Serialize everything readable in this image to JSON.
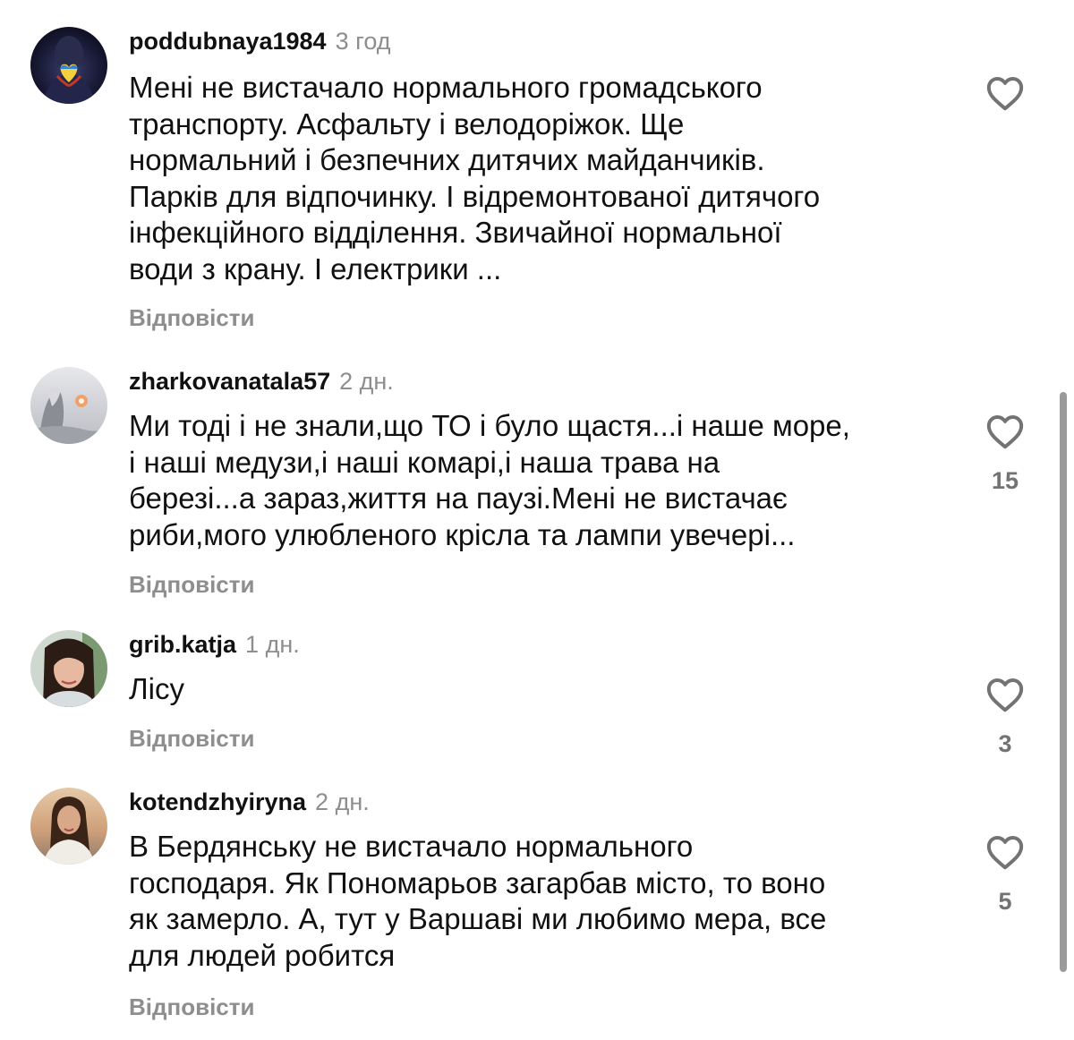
{
  "comments": [
    {
      "username": "poddubnaya1984",
      "time": "3 год",
      "text": "Мені не вистачало нормального громадського\nтранспорту.  Асфальту і велодоріжок.  Ще\nнормальний і безпечних дитячих майданчиків.\nПарків для відпочинку. І відремонтованої дитячого\nінфекційного відділення. Звичайної нормальної\nводи з крану. І електрики ...",
      "reply_label": "Відповісти",
      "likes": ""
    },
    {
      "username": "zharkovanatala57",
      "time": "2 дн.",
      "text": "Ми тоді і не знали,що ТО і було щастя...і наше море,\nі наші медузи,і наші комарі,і наша трава на\nберезі...а зараз,життя на паузі.Мені не вистачає\nриби,мого улюбленого крісла та лампи увечері...",
      "reply_label": "Відповісти",
      "likes": "15"
    },
    {
      "username": "grib.katja",
      "time": "1 дн.",
      "text": "Лісу",
      "reply_label": "Відповісти",
      "likes": "3"
    },
    {
      "username": "kotendzhyiryna",
      "time": "2 дн.",
      "text": "В Бердянську не вистачало нормального\nгосподаря. Як Пономарьов загарбав місто, то воно\nяк замерло. А, тут у Варшаві ми любимо мера, все\nдля людей робится",
      "reply_label": "Відповісти",
      "likes": "5"
    }
  ],
  "icons": {
    "like": "heart-outline-icon"
  },
  "colors": {
    "text": "#111111",
    "secondary": "#8e8e8e",
    "like_icon": "#737373"
  }
}
